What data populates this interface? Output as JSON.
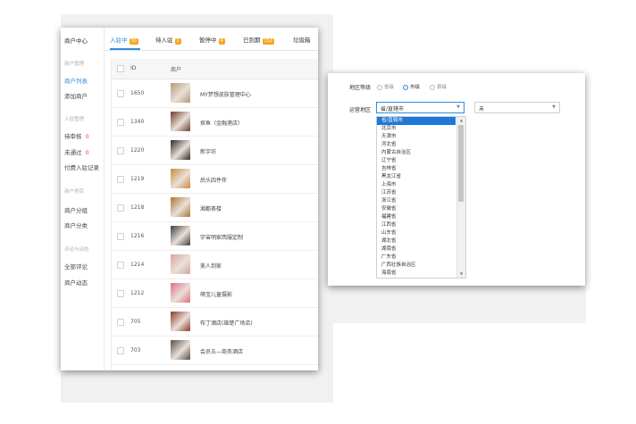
{
  "sidebar": {
    "header": "商户中心",
    "groups": [
      {
        "title": "商户管理",
        "items": [
          {
            "label": "商户列表",
            "active": true
          },
          {
            "label": "添加商户"
          }
        ]
      },
      {
        "title": "入驻管理",
        "items": [
          {
            "label": "待审核",
            "count": "0"
          },
          {
            "label": "未通过",
            "count": "0"
          },
          {
            "label": "付费入驻记录"
          }
        ]
      },
      {
        "title": "商户类目",
        "items": [
          {
            "label": "商户分组"
          },
          {
            "label": "商户分类"
          }
        ]
      },
      {
        "title": "评论与动态",
        "items": [
          {
            "label": "全部评论"
          },
          {
            "label": "商户动态"
          }
        ]
      }
    ]
  },
  "tabs": [
    {
      "label": "入驻中",
      "badge": "30",
      "active": true
    },
    {
      "label": "待入驻",
      "badge": "1"
    },
    {
      "label": "暂停中",
      "badge": "4"
    },
    {
      "label": "已到期",
      "badge": "152"
    },
    {
      "label": "垃圾箱"
    }
  ],
  "table": {
    "headers": {
      "id": "ID",
      "merchant": "商户"
    },
    "rows": [
      {
        "id": "1650",
        "name": "MY梦想皮肤管理中心",
        "thumb_color": "#b59a78"
      },
      {
        "id": "1340",
        "name": "探鱼（金融港店）",
        "thumb_color": "#6e3b2a"
      },
      {
        "id": "1220",
        "name": "新宇坊",
        "thumb_color": "#2a2a2a"
      },
      {
        "id": "1219",
        "name": "后头四件伴",
        "thumb_color": "#c98a3a"
      },
      {
        "id": "1218",
        "name": "湘都茶楼",
        "thumb_color": "#a8762f"
      },
      {
        "id": "1216",
        "name": "宇宙明家西服定制",
        "thumb_color": "#3d3d3d"
      },
      {
        "id": "1214",
        "name": "美人到家",
        "thumb_color": "#d9a4a0"
      },
      {
        "id": "1212",
        "name": "萌宝儿童摄影",
        "thumb_color": "#e06f86"
      },
      {
        "id": "705",
        "name": "布丁酒店(雄楚广场店)",
        "thumb_color": "#8c3a2a"
      },
      {
        "id": "703",
        "name": "会员五—商务酒店",
        "thumb_color": "#5a4a44"
      }
    ]
  },
  "region": {
    "level_label": "地区等级",
    "levels": [
      {
        "label": "省级",
        "checked": false
      },
      {
        "label": "市级",
        "checked": true
      },
      {
        "label": "县级",
        "checked": false
      }
    ],
    "area_label": "运营地区",
    "province_select": "省/直辖市",
    "city_select": "未",
    "options": [
      {
        "label": "省/直辖市",
        "selected": true
      },
      {
        "label": "北京市"
      },
      {
        "label": "天津市"
      },
      {
        "label": "河北省"
      },
      {
        "label": "内蒙古自治区"
      },
      {
        "label": "辽宁省"
      },
      {
        "label": "吉林省"
      },
      {
        "label": "黑龙江省"
      },
      {
        "label": "上海市"
      },
      {
        "label": "江苏省"
      },
      {
        "label": "浙江省"
      },
      {
        "label": "安徽省"
      },
      {
        "label": "福建省"
      },
      {
        "label": "江西省"
      },
      {
        "label": "山东省"
      },
      {
        "label": "湖北省"
      },
      {
        "label": "湖南省"
      },
      {
        "label": "广东省"
      },
      {
        "label": "广西壮族自治区"
      },
      {
        "label": "海南省"
      }
    ]
  },
  "colors": {
    "accent": "#2f8ee0",
    "badge": "#f5a623",
    "selected": "#1e78d7",
    "count": "#e0533b"
  }
}
